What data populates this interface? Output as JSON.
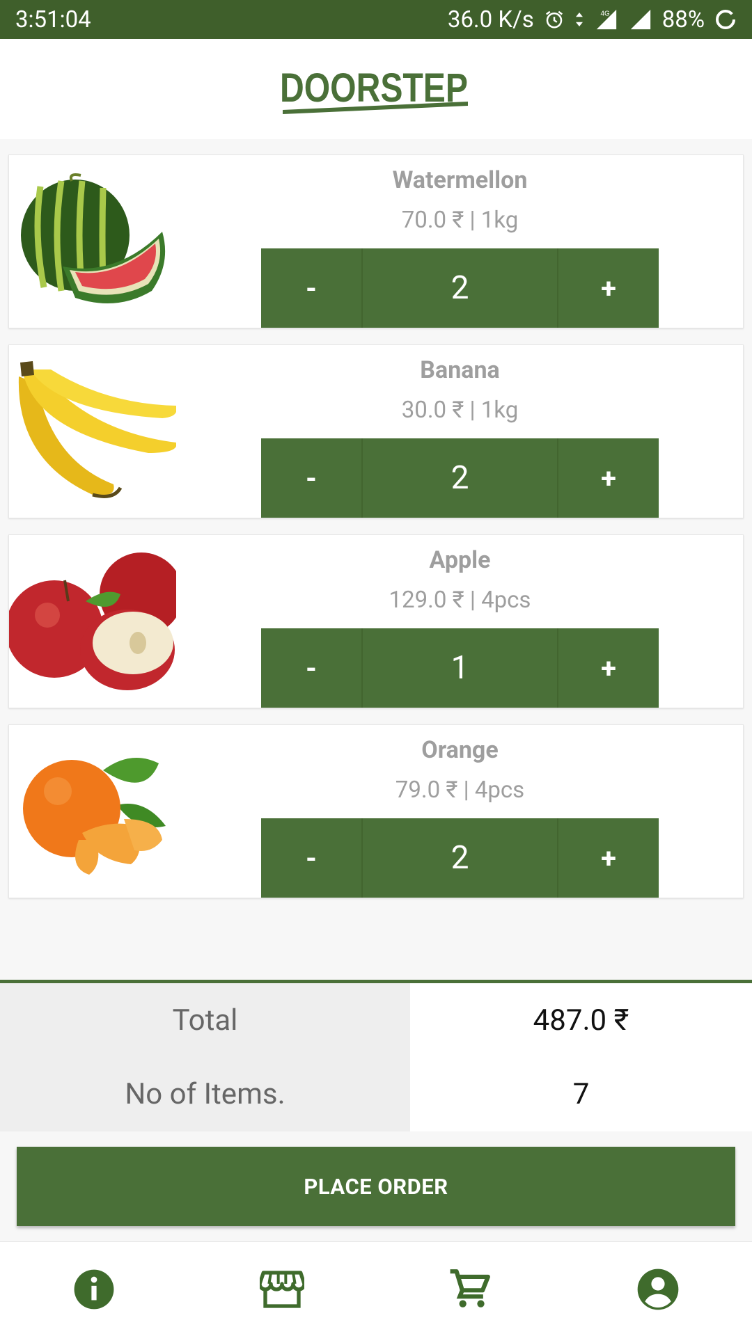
{
  "status_bar": {
    "time": "3:51:04",
    "network_speed": "36.0 K/s",
    "network_type": "4G",
    "battery": "88%"
  },
  "app": {
    "logo_text": "DOORSTEP",
    "brand_color": "#4a7038"
  },
  "cart_items": [
    {
      "name": "Watermellon",
      "price": "70.0 ₹ ",
      "unit": " | 1kg",
      "quantity": "2",
      "image": "watermelon-image"
    },
    {
      "name": "Banana",
      "price": "30.0 ₹ ",
      "unit": " | 1kg",
      "quantity": "2",
      "image": "banana-image"
    },
    {
      "name": "Apple",
      "price": "129.0 ₹ ",
      "unit": " | 4pcs",
      "quantity": "1",
      "image": "apple-image"
    },
    {
      "name": "Orange",
      "price": "79.0 ₹ ",
      "unit": " | 4pcs",
      "quantity": "2",
      "image": "orange-image"
    }
  ],
  "stepper": {
    "minus_label": "-",
    "plus_label": "+"
  },
  "summary": {
    "total_label": "Total",
    "total_value": "487.0 ₹",
    "items_label": "No of Items.",
    "items_value": "7"
  },
  "place_order_label": "PLACE ORDER",
  "bottom_nav": [
    "info-icon",
    "store-icon",
    "cart-icon",
    "account-icon"
  ]
}
